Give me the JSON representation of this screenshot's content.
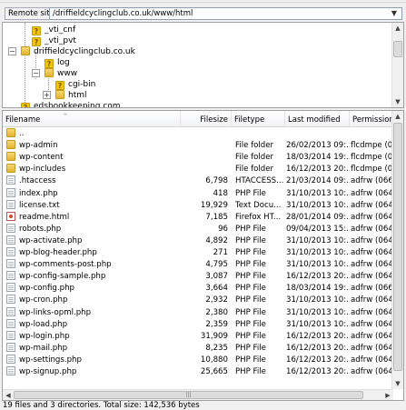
{
  "remote": {
    "label": "Remote site:",
    "path": "/driffieldcyclingclub.co.uk/www/html",
    "dropdown_glyph": "▼"
  },
  "tree": {
    "items": [
      {
        "label": "_vti_cnf",
        "icon": "unknown-folder-icon"
      },
      {
        "label": "_vti_pvt",
        "icon": "unknown-folder-icon"
      },
      {
        "label": "driffieldcyclingclub.co.uk",
        "icon": "folder-icon",
        "expander": "−"
      },
      {
        "label": "log",
        "icon": "unknown-folder-icon"
      },
      {
        "label": "www",
        "icon": "folder-icon",
        "expander": "−"
      },
      {
        "label": "cgi-bin",
        "icon": "unknown-folder-icon"
      },
      {
        "label": "html",
        "icon": "folder-icon",
        "expander": "+"
      },
      {
        "label": "edsbookkeeping.com",
        "icon": "unknown-folder-icon"
      }
    ]
  },
  "list": {
    "columns": [
      "Filename",
      "Filesize",
      "Filetype",
      "Last modified",
      "Permissions"
    ],
    "rows": [
      {
        "name": "..",
        "size": "",
        "type": "",
        "modified": "",
        "perm": "",
        "icon": "folder"
      },
      {
        "name": "wp-admin",
        "size": "",
        "type": "File folder",
        "modified": "26/02/2013 09:...",
        "perm": "flcdmpe (0755",
        "icon": "folder"
      },
      {
        "name": "wp-content",
        "size": "",
        "type": "File folder",
        "modified": "18/03/2014 19:...",
        "perm": "flcdmpe (0755",
        "icon": "folder"
      },
      {
        "name": "wp-includes",
        "size": "",
        "type": "File folder",
        "modified": "16/12/2013 20:...",
        "perm": "flcdmpe (0755",
        "icon": "folder"
      },
      {
        "name": ".htaccess",
        "size": "6,798",
        "type": "HTACCESS...",
        "modified": "21/03/2014 09:...",
        "perm": "adfrw (0666)",
        "icon": "file"
      },
      {
        "name": "index.php",
        "size": "418",
        "type": "PHP File",
        "modified": "31/10/2013 10:...",
        "perm": "adfrw (0644)",
        "icon": "file"
      },
      {
        "name": "license.txt",
        "size": "19,929",
        "type": "Text Docu...",
        "modified": "31/10/2013 10:...",
        "perm": "adfrw (0644)",
        "icon": "file"
      },
      {
        "name": "readme.html",
        "size": "7,185",
        "type": "Firefox HT...",
        "modified": "28/01/2014 09:...",
        "perm": "adfrw (0644)",
        "icon": "html"
      },
      {
        "name": "robots.php",
        "size": "96",
        "type": "PHP File",
        "modified": "09/04/2013 15:...",
        "perm": "adfrw (0644)",
        "icon": "file"
      },
      {
        "name": "wp-activate.php",
        "size": "4,892",
        "type": "PHP File",
        "modified": "31/10/2013 10:...",
        "perm": "adfrw (0644)",
        "icon": "file"
      },
      {
        "name": "wp-blog-header.php",
        "size": "271",
        "type": "PHP File",
        "modified": "31/10/2013 10:...",
        "perm": "adfrw (0644)",
        "icon": "file"
      },
      {
        "name": "wp-comments-post.php",
        "size": "4,795",
        "type": "PHP File",
        "modified": "31/10/2013 10:...",
        "perm": "adfrw (0644)",
        "icon": "file"
      },
      {
        "name": "wp-config-sample.php",
        "size": "3,087",
        "type": "PHP File",
        "modified": "16/12/2013 20:...",
        "perm": "adfrw (0644)",
        "icon": "file"
      },
      {
        "name": "wp-config.php",
        "size": "3,664",
        "type": "PHP File",
        "modified": "18/03/2014 19:...",
        "perm": "adfrw (0666)",
        "icon": "file"
      },
      {
        "name": "wp-cron.php",
        "size": "2,932",
        "type": "PHP File",
        "modified": "31/10/2013 10:...",
        "perm": "adfrw (0644)",
        "icon": "file"
      },
      {
        "name": "wp-links-opml.php",
        "size": "2,380",
        "type": "PHP File",
        "modified": "31/10/2013 10:...",
        "perm": "adfrw (0644)",
        "icon": "file"
      },
      {
        "name": "wp-load.php",
        "size": "2,359",
        "type": "PHP File",
        "modified": "31/10/2013 10:...",
        "perm": "adfrw (0644)",
        "icon": "file"
      },
      {
        "name": "wp-login.php",
        "size": "31,909",
        "type": "PHP File",
        "modified": "16/12/2013 20:...",
        "perm": "adfrw (0644)",
        "icon": "file"
      },
      {
        "name": "wp-mail.php",
        "size": "8,235",
        "type": "PHP File",
        "modified": "16/12/2013 20:...",
        "perm": "adfrw (0644)",
        "icon": "file"
      },
      {
        "name": "wp-settings.php",
        "size": "10,880",
        "type": "PHP File",
        "modified": "16/12/2013 20:...",
        "perm": "adfrw (0644)",
        "icon": "file"
      },
      {
        "name": "wp-signup.php",
        "size": "25,665",
        "type": "PHP File",
        "modified": "16/12/2013 20:...",
        "perm": "adfrw (0644)",
        "icon": "file"
      }
    ]
  },
  "status": {
    "text": "19 files and 3 directories. Total size: 142,536 bytes"
  },
  "colors": {
    "folder": "#e9c24a",
    "unknown_folder": "#f1c40f",
    "unknown_mark": "#7a5a00"
  }
}
